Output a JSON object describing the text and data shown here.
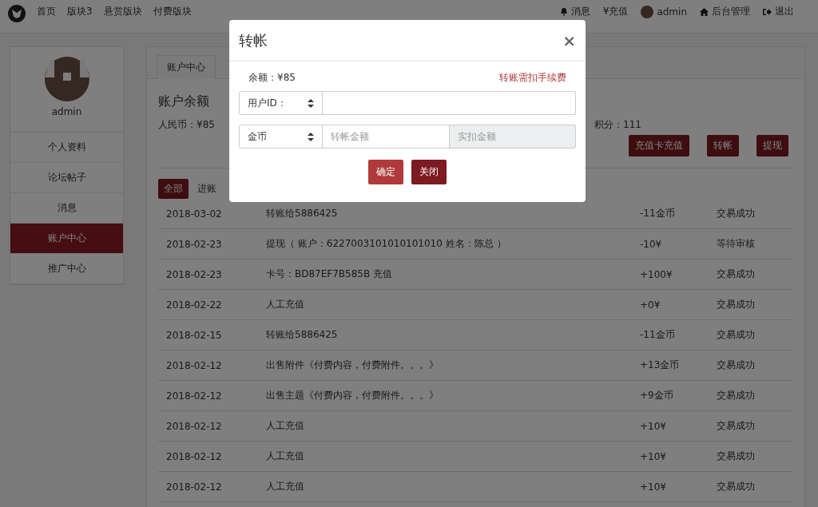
{
  "nav": {
    "links": [
      {
        "label": "首页"
      },
      {
        "label": "版块3"
      },
      {
        "label": "悬赏版块"
      },
      {
        "label": "付费版块"
      }
    ],
    "right": [
      {
        "kind": "bell",
        "label": "消息"
      },
      {
        "kind": "text",
        "label": "¥充值"
      },
      {
        "kind": "avatar",
        "label": "admin"
      },
      {
        "kind": "home",
        "label": "后台管理"
      },
      {
        "kind": "exit",
        "label": "退出"
      }
    ]
  },
  "sidebar": {
    "username": "admin",
    "items": [
      {
        "label": "个人资料",
        "selected": false
      },
      {
        "label": "论坛帖子",
        "selected": false
      },
      {
        "label": "消息",
        "selected": false
      },
      {
        "label": "账户中心",
        "selected": true
      },
      {
        "label": "推广中心",
        "selected": false
      }
    ]
  },
  "main": {
    "tab": "账户中心",
    "heading": "账户余额",
    "rmb": "人民币：¥85",
    "points": "积分：111",
    "actions": [
      "充值卡充值",
      "转帐",
      "提现"
    ],
    "filters": [
      {
        "label": "全部",
        "selected": true
      },
      {
        "label": "进账",
        "selected": false
      }
    ],
    "rows": [
      [
        "2018-03-02",
        "转账给5886425",
        "-11金币",
        "交易成功"
      ],
      [
        "2018-02-23",
        "提现（ 账户：6227003101010101010 姓名：陈总 ）",
        "-10¥",
        "等待审核"
      ],
      [
        "2018-02-23",
        "卡号：BD87EF7B585B 充值",
        "+100¥",
        "交易成功"
      ],
      [
        "2018-02-22",
        "人工充值",
        "+0¥",
        "交易成功"
      ],
      [
        "2018-02-15",
        "转账给5886425",
        "-11金币",
        "交易成功"
      ],
      [
        "2018-02-12",
        "出售附件《付费内容，付费附件。。。》",
        "+13金币",
        "交易成功"
      ],
      [
        "2018-02-12",
        "出售主题《付费内容，付费附件。。。》",
        "+9金币",
        "交易成功"
      ],
      [
        "2018-02-12",
        "人工充值",
        "+10¥",
        "交易成功"
      ],
      [
        "2018-02-12",
        "人工充值",
        "+10¥",
        "交易成功"
      ],
      [
        "2018-02-12",
        "人工充值",
        "+10¥",
        "交易成功"
      ]
    ]
  },
  "modal": {
    "title": "转帐",
    "close": "×",
    "balance": "余额：¥85",
    "fee_note": "转账需扣手续费",
    "id_select": "用户ID：",
    "currency_select": "金币",
    "amount_placeholder": "转帐金额",
    "deduct_placeholder": "实扣金额",
    "buttons": [
      {
        "kind": "primary",
        "label": "确定"
      },
      {
        "kind": "dark",
        "label": "关闭"
      }
    ]
  }
}
